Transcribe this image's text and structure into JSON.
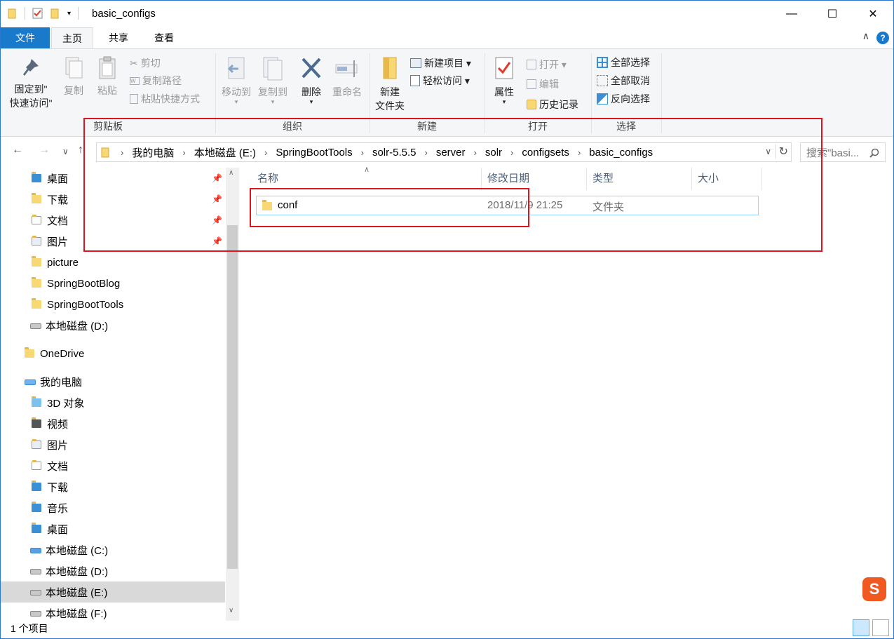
{
  "window": {
    "title": "basic_configs",
    "controls": {
      "minimize": "—",
      "maximize": "☐",
      "close": "✕"
    }
  },
  "ribbon_tabs": [
    "文件",
    "主页",
    "共享",
    "查看"
  ],
  "help_label": "?",
  "ribbon": {
    "clipboard": {
      "pin_label_1": "固定到\"",
      "pin_label_2": "快速访问\"",
      "copy": "复制",
      "paste": "粘贴",
      "cut": "剪切",
      "copy_path": "复制路径",
      "paste_shortcut": "粘贴快捷方式",
      "group": "剪贴板"
    },
    "organize": {
      "move_to": "移动到",
      "copy_to": "复制到",
      "delete": "删除",
      "rename": "重命名",
      "group": "组织"
    },
    "new": {
      "new_folder_1": "新建",
      "new_folder_2": "文件夹",
      "new_item": "新建项目 ▾",
      "easy_access": "轻松访问 ▾",
      "group": "新建"
    },
    "open": {
      "properties": "属性",
      "open": "打开 ▾",
      "edit": "编辑",
      "history": "历史记录",
      "group": "打开"
    },
    "select": {
      "select_all": "全部选择",
      "select_none": "全部取消",
      "invert": "反向选择",
      "group": "选择"
    }
  },
  "nav": {
    "back": "←",
    "forward": "→",
    "recent": "∨",
    "up": "↑",
    "breadcrumb": [
      "我的电脑",
      "本地磁盘 (E:)",
      "SpringBootTools",
      "solr-5.5.5",
      "server",
      "solr",
      "configsets",
      "basic_configs"
    ],
    "search_placeholder": "搜索\"basi...",
    "refresh": "↻",
    "dropdown": "∨"
  },
  "sidebar": {
    "quick_access": [
      "桌面",
      "下载",
      "文档",
      "图片"
    ],
    "folders": [
      "picture",
      "SpringBootBlog",
      "SpringBootTools",
      "本地磁盘 (D:)"
    ],
    "onedrive": "OneDrive",
    "this_pc": "我的电脑",
    "pc_items": [
      "3D 对象",
      "视频",
      "图片",
      "文档",
      "下载",
      "音乐",
      "桌面",
      "本地磁盘 (C:)",
      "本地磁盘 (D:)",
      "本地磁盘 (E:)",
      "本地磁盘 (F:)"
    ]
  },
  "columns": [
    "名称",
    "修改日期",
    "类型",
    "大小"
  ],
  "files": [
    {
      "name": "conf",
      "date": "2018/11/9 21:25",
      "type": "文件夹",
      "size": ""
    }
  ],
  "status_text": "1 个项目",
  "ime_label": "S"
}
